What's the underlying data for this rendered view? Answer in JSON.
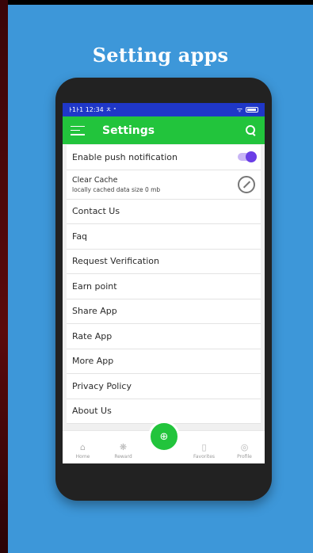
{
  "promo": {
    "title": "Setting apps"
  },
  "statusbar": {
    "time": "ﾄ1ﾄ1 12:34 ㅊ ᐤ",
    "right": "ᯤ"
  },
  "appbar": {
    "title": "Settings"
  },
  "settings": {
    "push": {
      "label": "Enable push notification",
      "enabled": true
    },
    "cache": {
      "label": "Clear Cache",
      "sub": "locally cached data size 0 mb"
    },
    "items": [
      "Contact Us",
      "Faq",
      "Request Verification",
      "Earn point",
      "Share App",
      "Rate App",
      "More App",
      "Privacy Policy",
      "About Us"
    ]
  },
  "bottom_nav": {
    "home": {
      "label": "Home",
      "icon": "home-icon"
    },
    "reward": {
      "label": "Reward",
      "icon": "reward-icon"
    },
    "fab": {
      "icon": "add-icon"
    },
    "favorites": {
      "label": "Favorites",
      "icon": "bookmark-icon"
    },
    "profile": {
      "label": "Profile",
      "icon": "profile-icon"
    }
  },
  "colors": {
    "background": "#3d97d9",
    "appbar": "#22c43c",
    "statusbar": "#1f37c8",
    "toggle": "#6a3ee6"
  }
}
